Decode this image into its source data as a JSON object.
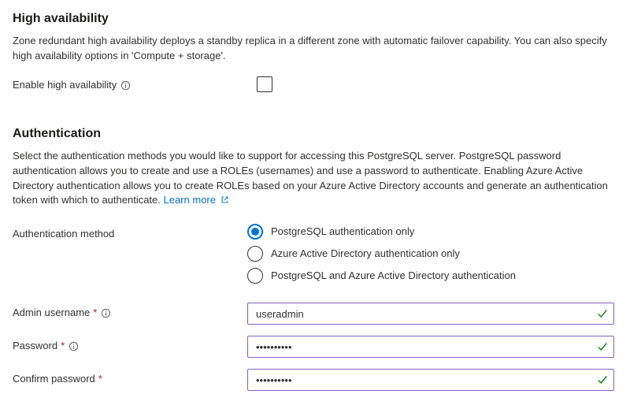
{
  "ha": {
    "heading": "High availability",
    "description": "Zone redundant high availability deploys a standby replica in a different zone with automatic failover capability. You can also specify high availability options in 'Compute + storage'.",
    "enable_label": "Enable high availability",
    "enabled": false
  },
  "auth": {
    "heading": "Authentication",
    "description_pre": "Select the authentication methods you would like to support for accessing this PostgreSQL server. PostgreSQL password authentication allows you to create and use a ROLEs (usernames) and use a password to authenticate. Enabling Azure Active Directory authentication allows you to create ROLEs based on your Azure Active Directory accounts and generate an authentication token with which to authenticate. ",
    "learn_more": "Learn more",
    "method_label": "Authentication method",
    "options": [
      {
        "label": "PostgreSQL authentication only",
        "selected": true
      },
      {
        "label": "Azure Active Directory authentication only",
        "selected": false
      },
      {
        "label": "PostgreSQL and Azure Active Directory authentication",
        "selected": false
      }
    ],
    "admin_username_label": "Admin username",
    "admin_username_value": "useradmin",
    "password_label": "Password",
    "password_value": "••••••••••",
    "confirm_password_label": "Confirm password",
    "confirm_password_value": "••••••••••"
  }
}
